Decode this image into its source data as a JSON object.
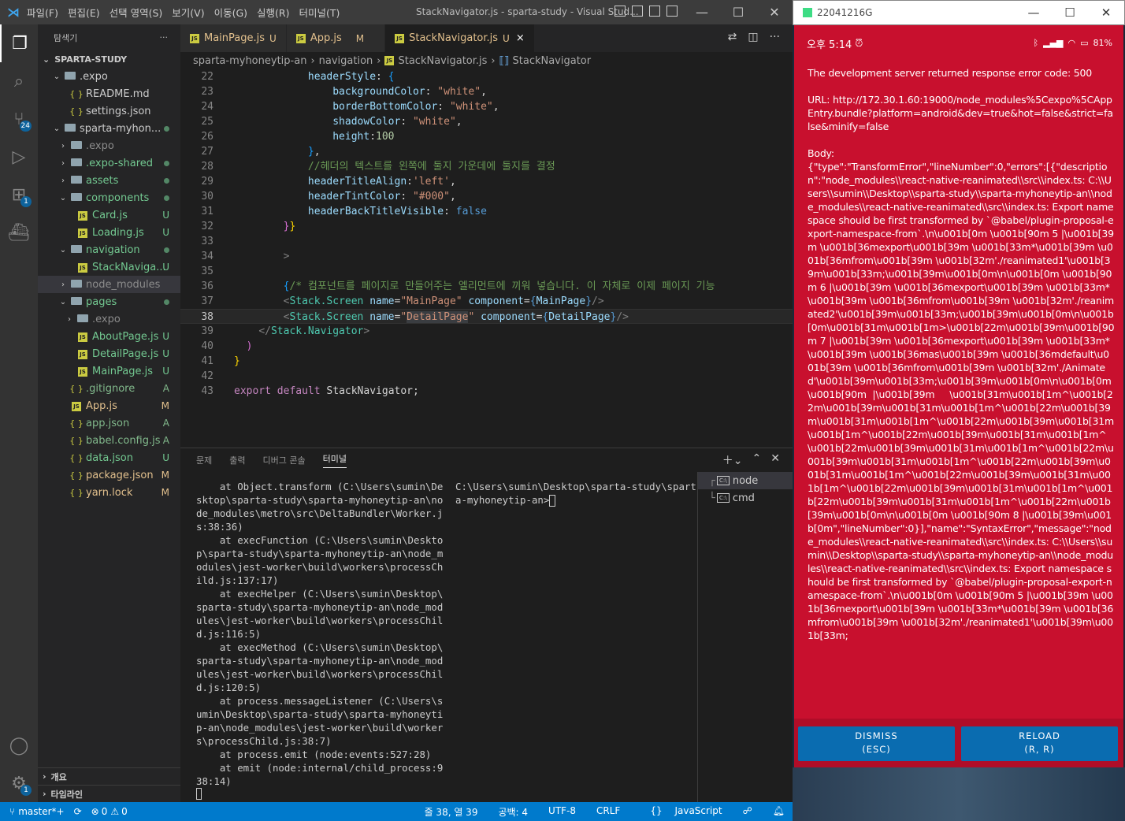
{
  "vscode": {
    "menu": [
      "파일(F)",
      "편집(E)",
      "선택 영역(S)",
      "보기(V)",
      "이동(G)",
      "실행(R)",
      "터미널(T)"
    ],
    "window_title": "StackNavigator.js - sparta-study - Visual Stud...",
    "activity_badges": {
      "scm": "24",
      "extensions": "1",
      "settings": "1"
    },
    "explorer": {
      "header": "탐색기",
      "root": "SPARTA-STUDY",
      "items": [
        {
          "label": ".expo",
          "status": "",
          "color": "#cccccc"
        },
        {
          "label": "README.md",
          "status": "",
          "color": "#cccccc"
        },
        {
          "label": "settings.json",
          "status": "",
          "color": "#cccccc"
        },
        {
          "label": "sparta-myhon...",
          "status": "",
          "color": "#cccccc"
        },
        {
          "label": ".expo",
          "status": "",
          "color": "#8c8c8c"
        },
        {
          "label": ".expo-shared",
          "status": "",
          "color": "#73c991"
        },
        {
          "label": "assets",
          "status": "",
          "color": "#73c991"
        },
        {
          "label": "components",
          "status": "",
          "color": "#73c991"
        },
        {
          "label": "Card.js",
          "status": "U",
          "color": "#73c991"
        },
        {
          "label": "Loading.js",
          "status": "U",
          "color": "#73c991"
        },
        {
          "label": "navigation",
          "status": "",
          "color": "#73c991"
        },
        {
          "label": "StackNaviga...",
          "status": "U",
          "color": "#73c991"
        },
        {
          "label": "node_modules",
          "status": "",
          "color": "#8c8c8c"
        },
        {
          "label": "pages",
          "status": "",
          "color": "#73c991"
        },
        {
          "label": ".expo",
          "status": "",
          "color": "#8c8c8c"
        },
        {
          "label": "AboutPage.js",
          "status": "U",
          "color": "#73c991"
        },
        {
          "label": "DetailPage.js",
          "status": "U",
          "color": "#73c991"
        },
        {
          "label": "MainPage.js",
          "status": "U",
          "color": "#73c991"
        },
        {
          "label": ".gitignore",
          "status": "A",
          "color": "#81b88b"
        },
        {
          "label": "App.js",
          "status": "M",
          "color": "#e2c08d"
        },
        {
          "label": "app.json",
          "status": "A",
          "color": "#81b88b"
        },
        {
          "label": "babel.config.js",
          "status": "A",
          "color": "#81b88b"
        },
        {
          "label": "data.json",
          "status": "U",
          "color": "#73c991"
        },
        {
          "label": "package.json",
          "status": "M",
          "color": "#e2c08d"
        },
        {
          "label": "yarn.lock",
          "status": "M",
          "color": "#e2c08d"
        }
      ],
      "outline": "개요",
      "timeline": "타임라인"
    },
    "tabs": [
      {
        "label": "MainPage.js",
        "mark": "U"
      },
      {
        "label": "App.js",
        "mark": "M"
      },
      {
        "label": "StackNavigator.js",
        "mark": "U",
        "close": "×"
      }
    ],
    "breadcrumb": [
      "sparta-myhoneytip-an",
      "navigation",
      "StackNavigator.js",
      "StackNavigator"
    ],
    "editor": {
      "line_numbers": [
        "22",
        "23",
        "24",
        "25",
        "26",
        "27",
        "28",
        "29",
        "30",
        "31",
        "32",
        "33",
        "34",
        "35",
        "36",
        "37",
        "38",
        "39",
        "40",
        "41",
        "42",
        "43"
      ],
      "current_line": "38"
    },
    "panel": {
      "tabs": [
        "문제",
        "출력",
        "디버그 콘솔",
        "터미널"
      ],
      "active_tab": "터미널",
      "terminal_left": "    at Object.transform (C:\\Users\\sumin\\De\nsktop\\sparta-study\\sparta-myhoneytip-an\\no\nde_modules\\metro\\src\\DeltaBundler\\Worker.j\ns:38:36)\n    at execFunction (C:\\Users\\sumin\\Deskto\np\\sparta-study\\sparta-myhoneytip-an\\node_m\nodules\\jest-worker\\build\\workers\\processCh\nild.js:137:17)\n    at execHelper (C:\\Users\\sumin\\Desktop\\\nsparta-study\\sparta-myhoneytip-an\\node_mod\nules\\jest-worker\\build\\workers\\processChil\nd.js:116:5)\n    at execMethod (C:\\Users\\sumin\\Desktop\\\nsparta-study\\sparta-myhoneytip-an\\node_mod\nules\\jest-worker\\build\\workers\\processChil\nd.js:120:5)\n    at process.messageListener (C:\\Users\\s\numin\\Desktop\\sparta-study\\sparta-myhoneyti\np-an\\node_modules\\jest-worker\\build\\worker\ns\\processChild.js:38:7)\n    at process.emit (node:events:527:28)\n    at emit (node:internal/child_process:9\n38:14)",
      "terminal_right": "C:\\Users\\sumin\\Desktop\\sparta-study\\spart\na-myhoneytip-an>",
      "terminal_list": [
        "node",
        "cmd"
      ]
    },
    "status": {
      "branch": "master*+",
      "errors": "0",
      "warnings": "0",
      "position": "줄 38, 열 39",
      "spaces": "공백: 4",
      "encoding": "UTF-8",
      "eol": "CRLF",
      "language": "JavaScript"
    }
  },
  "emulator": {
    "title": "22041216G",
    "time": "오후 5:14",
    "battery": "81%",
    "error_text": "The development server returned response error code: 500\n\nURL: http://172.30.1.60:19000/node_modules%5Cexpo%5CAppEntry.bundle?platform=android&dev=true&hot=false&strict=false&minify=false\n\nBody:\n{\"type\":\"TransformError\",\"lineNumber\":0,\"errors\":[{\"description\":\"node_modules\\\\react-native-reanimated\\\\src\\\\index.ts: C:\\\\Users\\\\sumin\\\\Desktop\\\\sparta-study\\\\sparta-myhoneytip-an\\\\node_modules\\\\react-native-reanimated\\\\src\\\\index.ts: Export namespace should be first transformed by `@babel/plugin-proposal-export-namespace-from`.\\n\\u001b[0m \\u001b[90m 5 |\\u001b[39m \\u001b[36mexport\\u001b[39m \\u001b[33m*\\u001b[39m \\u001b[36mfrom\\u001b[39m \\u001b[32m'./reanimated1'\\u001b[39m\\u001b[33m;\\u001b[39m\\u001b[0m\\n\\u001b[0m \\u001b[90m 6 |\\u001b[39m \\u001b[36mexport\\u001b[39m \\u001b[33m*\\u001b[39m \\u001b[36mfrom\\u001b[39m \\u001b[32m'./reanimated2'\\u001b[39m\\u001b[33m;\\u001b[39m\\u001b[0m\\n\\u001b[0m\\u001b[31m\\u001b[1m>\\u001b[22m\\u001b[39m\\u001b[90m 7 |\\u001b[39m \\u001b[36mexport\\u001b[39m \\u001b[33m*\\u001b[39m \\u001b[36mas\\u001b[39m \\u001b[36mdefault\\u001b[39m \\u001b[36mfrom\\u001b[39m \\u001b[32m'./Animated'\\u001b[39m\\u001b[33m;\\u001b[39m\\u001b[0m\\n\\u001b[0m \\u001b[90m  |\\u001b[39m     \\u001b[31m\\u001b[1m^\\u001b[22m\\u001b[39m\\u001b[31m\\u001b[1m^\\u001b[22m\\u001b[39m\\u001b[31m\\u001b[1m^\\u001b[22m\\u001b[39m\\u001b[31m\\u001b[1m^\\u001b[22m\\u001b[39m\\u001b[31m\\u001b[1m^\\u001b[22m\\u001b[39m\\u001b[31m\\u001b[1m^\\u001b[22m\\u001b[39m\\u001b[31m\\u001b[1m^\\u001b[22m\\u001b[39m\\u001b[31m\\u001b[1m^\\u001b[22m\\u001b[39m\\u001b[31m\\u001b[1m^\\u001b[22m\\u001b[39m\\u001b[31m\\u001b[1m^\\u001b[22m\\u001b[39m\\u001b[31m\\u001b[1m^\\u001b[22m\\u001b[39m\\u001b[0m\\n\\u001b[0m \\u001b[90m 8 |\\u001b[39m\\u001b[0m\",\"lineNumber\":0}],\"name\":\"SyntaxError\",\"message\":\"node_modules\\\\react-native-reanimated\\\\src\\\\index.ts: C:\\\\Users\\\\sumin\\\\Desktop\\\\sparta-study\\\\sparta-myhoneytip-an\\\\node_modules\\\\react-native-reanimated\\\\src\\\\index.ts: Export namespace should be first transformed by `@babel/plugin-proposal-export-namespace-from`.\\n\\u001b[0m \\u001b[90m 5 |\\u001b[39m \\u001b[36mexport\\u001b[39m \\u001b[33m*\\u001b[39m \\u001b[36mfrom\\u001b[39m \\u001b[32m'./reanimated1'\\u001b[39m\\u001b[33m;",
    "dismiss": "DISMISS\n(ESC)",
    "reload": "RELOAD\n(R, R)"
  }
}
